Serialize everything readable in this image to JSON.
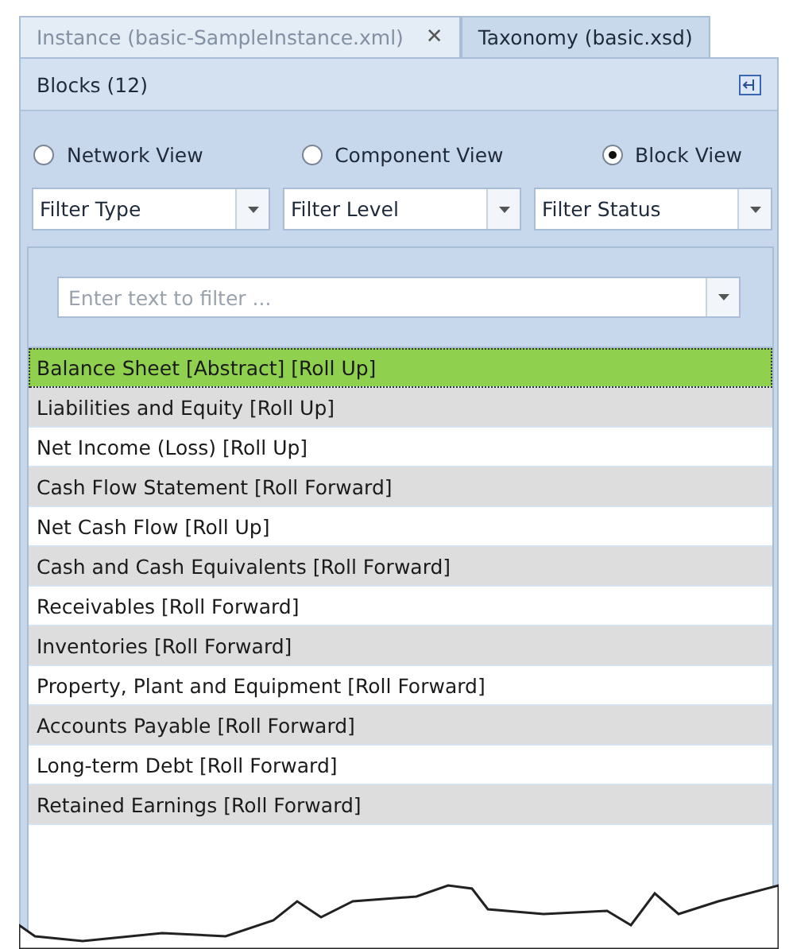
{
  "tabs": [
    {
      "label": "Instance (basic-SampleInstance.xml)",
      "selected": false,
      "close_glyph": "✕"
    },
    {
      "label": "Taxonomy (basic.xsd)",
      "selected": true
    }
  ],
  "panel": {
    "title": "Blocks (12)"
  },
  "views": [
    {
      "label": "Network View",
      "selected": false
    },
    {
      "label": "Component View",
      "selected": false
    },
    {
      "label": "Block View",
      "selected": true
    }
  ],
  "filters": [
    "Filter Type",
    "Filter Level",
    "Filter Status"
  ],
  "search": {
    "placeholder": "Enter text to filter ..."
  },
  "rows": [
    {
      "label": "Balance Sheet [Abstract] [Roll Up]",
      "selected": true
    },
    {
      "label": "Liabilities and Equity [Roll Up]",
      "selected": false
    },
    {
      "label": "Net Income (Loss) [Roll Up]",
      "selected": false
    },
    {
      "label": "Cash Flow Statement [Roll Forward]",
      "selected": false
    },
    {
      "label": "Net Cash Flow [Roll Up]",
      "selected": false
    },
    {
      "label": "Cash and Cash Equivalents [Roll Forward]",
      "selected": false
    },
    {
      "label": "Receivables [Roll Forward]",
      "selected": false
    },
    {
      "label": "Inventories [Roll Forward]",
      "selected": false
    },
    {
      "label": "Property, Plant and Equipment [Roll Forward]",
      "selected": false
    },
    {
      "label": "Accounts Payable [Roll Forward]",
      "selected": false
    },
    {
      "label": "Long-term Debt [Roll Forward]",
      "selected": false
    },
    {
      "label": "Retained Earnings [Roll Forward]",
      "selected": false
    }
  ]
}
